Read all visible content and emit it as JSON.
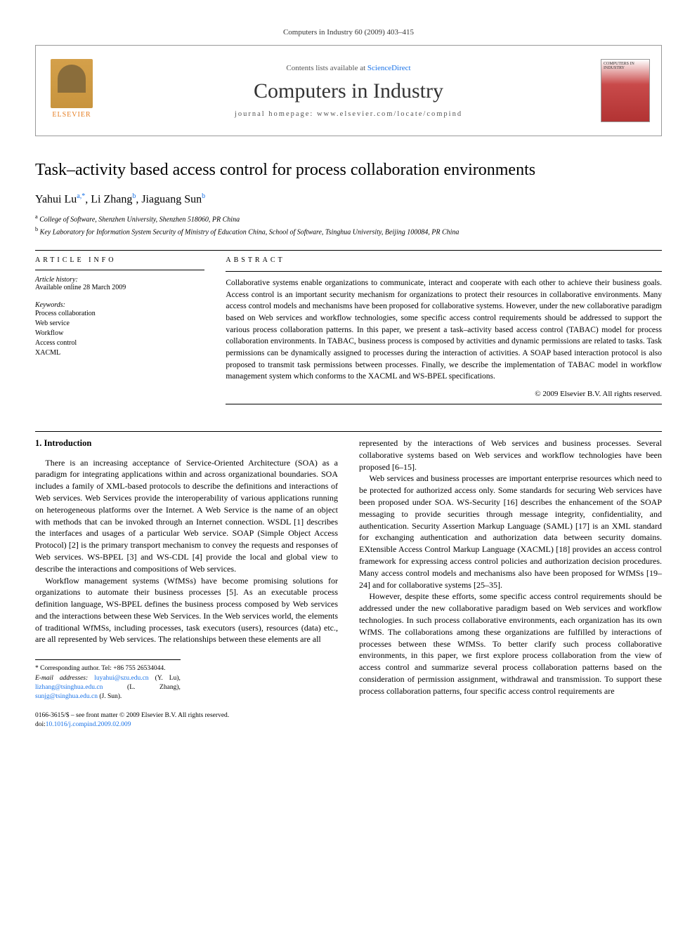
{
  "header": {
    "running_head": "Computers in Industry 60 (2009) 403–415"
  },
  "masthead": {
    "elsevier_label": "ELSEVIER",
    "contents_prefix": "Contents lists available at ",
    "contents_link": "ScienceDirect",
    "journal_name": "Computers in Industry",
    "homepage_label": "journal homepage: www.elsevier.com/locate/compind",
    "cover_text": "COMPUTERS IN INDUSTRY"
  },
  "article": {
    "title": "Task–activity based access control for process collaboration environments",
    "authors_html": "Yahui Lu ",
    "authors": [
      {
        "name": "Yahui Lu",
        "markers": "a,*"
      },
      {
        "name": "Li Zhang",
        "markers": "b"
      },
      {
        "name": "Jiaguang Sun",
        "markers": "b"
      }
    ],
    "affiliations": [
      {
        "marker": "a",
        "text": "College of Software, Shenzhen University, Shenzhen 518060, PR China"
      },
      {
        "marker": "b",
        "text": "Key Laboratory for Information System Security of Ministry of Education China, School of Software, Tsinghua University, Beijing 100084, PR China"
      }
    ]
  },
  "info": {
    "heading": "ARTICLE INFO",
    "history_label": "Article history:",
    "history_value": "Available online 28 March 2009",
    "keywords_label": "Keywords:",
    "keywords": [
      "Process collaboration",
      "Web service",
      "Workflow",
      "Access control",
      "XACML"
    ]
  },
  "abstract": {
    "heading": "ABSTRACT",
    "text": "Collaborative systems enable organizations to communicate, interact and cooperate with each other to achieve their business goals. Access control is an important security mechanism for organizations to protect their resources in collaborative environments. Many access control models and mechanisms have been proposed for collaborative systems. However, under the new collaborative paradigm based on Web services and workflow technologies, some specific access control requirements should be addressed to support the various process collaboration patterns. In this paper, we present a task–activity based access control (TABAC) model for process collaboration environments. In TABAC, business process is composed by activities and dynamic permissions are related to tasks. Task permissions can be dynamically assigned to processes during the interaction of activities. A SOAP based interaction protocol is also proposed to transmit task permissions between processes. Finally, we describe the implementation of TABAC model in workflow management system which conforms to the XACML and WS-BPEL specifications.",
    "copyright": "© 2009 Elsevier B.V. All rights reserved."
  },
  "body": {
    "section1_heading": "1. Introduction",
    "left_p1": "There is an increasing acceptance of Service-Oriented Architecture (SOA) as a paradigm for integrating applications within and across organizational boundaries. SOA includes a family of XML-based protocols to describe the definitions and interactions of Web services. Web Services provide the interoperability of various applications running on heterogeneous platforms over the Internet. A Web Service is the name of an object with methods that can be invoked through an Internet connection. WSDL [1] describes the interfaces and usages of a particular Web service. SOAP (Simple Object Access Protocol) [2] is the primary transport mechanism to convey the requests and responses of Web services. WS-BPEL [3] and WS-CDL [4] provide the local and global view to describe the interactions and compositions of Web services.",
    "left_p2": "Workflow management systems (WfMSs) have become promising solutions for organizations to automate their business processes [5]. As an executable process definition language, WS-BPEL defines the business process composed by Web services and the interactions between these Web Services. In the Web services world, the elements of traditional WfMSs, including processes, task executors (users), resources (data) etc., are all represented by Web services. The relationships between these elements are all",
    "right_p1": "represented by the interactions of Web services and business processes. Several collaborative systems based on Web services and workflow technologies have been proposed [6–15].",
    "right_p2": "Web services and business processes are important enterprise resources which need to be protected for authorized access only. Some standards for securing Web services have been proposed under SOA. WS-Security [16] describes the enhancement of the SOAP messaging to provide securities through message integrity, confidentiality, and authentication. Security Assertion Markup Language (SAML) [17] is an XML standard for exchanging authentication and authorization data between security domains. EXtensible Access Control Markup Language (XACML) [18] provides an access control framework for expressing access control policies and authorization decision procedures. Many access control models and mechanisms also have been proposed for WfMSs [19–24] and for collaborative systems [25–35].",
    "right_p3": "However, despite these efforts, some specific access control requirements should be addressed under the new collaborative paradigm based on Web services and workflow technologies. In such process collaborative environments, each organization has its own WfMS. The collaborations among these organizations are fulfilled by interactions of processes between these WfMSs. To better clarify such process collaborative environments, in this paper, we first explore process collaboration from the view of access control and summarize several process collaboration patterns based on the consideration of permission assignment, withdrawal and transmission. To support these process collaboration patterns, four specific access control requirements are"
  },
  "footnotes": {
    "corresponding": "* Corresponding author. Tel: +86 755 26534044.",
    "emails_label": "E-mail addresses:",
    "emails": [
      {
        "addr": "luyahui@szu.edu.cn",
        "who": "(Y. Lu)"
      },
      {
        "addr": "lizhang@tsinghua.edu.cn",
        "who": "(L. Zhang)"
      },
      {
        "addr": "sunjg@tsinghua.edu.cn",
        "who": "(J. Sun)"
      }
    ]
  },
  "bottom": {
    "issn_line": "0166-3615/$ – see front matter © 2009 Elsevier B.V. All rights reserved.",
    "doi_prefix": "doi:",
    "doi": "10.1016/j.compind.2009.02.009"
  }
}
